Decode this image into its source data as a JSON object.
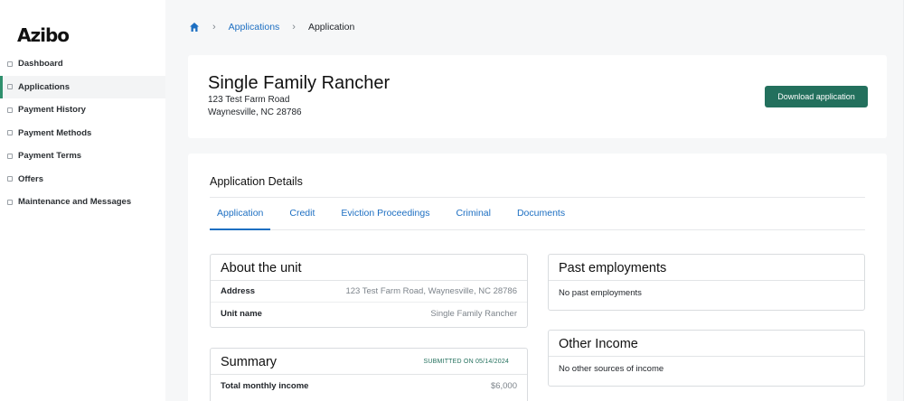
{
  "sidebar": {
    "logo": "Azibo",
    "items": [
      {
        "label": "Dashboard",
        "icon": "home-icon"
      },
      {
        "label": "Applications",
        "icon": "document-icon",
        "active": true
      },
      {
        "label": "Payment History",
        "icon": "receipt-icon"
      },
      {
        "label": "Payment Methods",
        "icon": "card-icon"
      },
      {
        "label": "Payment Terms",
        "icon": "calendar-icon"
      },
      {
        "label": "Offers",
        "icon": "gift-icon"
      },
      {
        "label": "Maintenance and Messages",
        "icon": "message-icon"
      }
    ]
  },
  "breadcrumb": {
    "home_icon": "home-icon",
    "items": [
      "Applications",
      "Application"
    ]
  },
  "header": {
    "title": "Single Family Rancher",
    "address_line1": "123 Test Farm Road",
    "address_line2": "Waynesville, NC 28786",
    "download_label": "Download application"
  },
  "details": {
    "title": "Application Details",
    "tabs": [
      "Application",
      "Credit",
      "Eviction Proceedings",
      "Criminal",
      "Documents"
    ],
    "active_tab": "Application"
  },
  "about_unit": {
    "title": "About the unit",
    "rows": [
      {
        "label": "Address",
        "value": "123 Test Farm Road, Waynesville, NC 28786"
      },
      {
        "label": "Unit name",
        "value": "Single Family Rancher"
      }
    ]
  },
  "summary": {
    "title": "Summary",
    "submitted": "SUBMITTED ON 05/14/2024",
    "rows": [
      {
        "label": "Total monthly income",
        "value": "$6,000"
      }
    ]
  },
  "past_employments": {
    "title": "Past employments",
    "text": "No past employments"
  },
  "other_income": {
    "title": "Other Income",
    "text": "No other sources of income"
  },
  "colors": {
    "accent_green": "#23705d",
    "link_blue": "#1d6fc2"
  }
}
